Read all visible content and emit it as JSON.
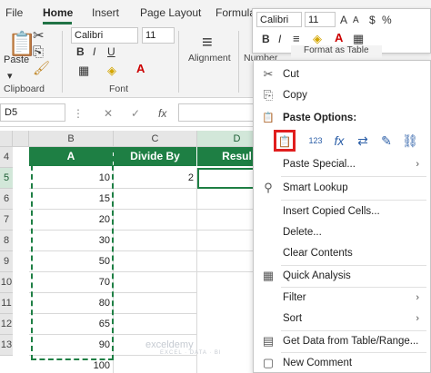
{
  "ribbon": {
    "tabs": [
      "File",
      "Home",
      "Insert",
      "Page Layout",
      "Formula"
    ],
    "active_tab": "Home",
    "paste_label": "Paste",
    "clipboard_label": "Clipboard",
    "font_name": "Calibri",
    "font_size": "11",
    "font_label": "Font",
    "alignment_label": "Alignment",
    "number_label": "Number",
    "format_as_table": "Format as Table"
  },
  "formula_bar": {
    "name_box": "D5",
    "fx": "fx"
  },
  "columns": [
    "B",
    "C",
    "D"
  ],
  "row_numbers": [
    "4",
    "5",
    "6",
    "7",
    "8",
    "9",
    "10",
    "11",
    "12",
    "13"
  ],
  "table": {
    "headers": [
      "A",
      "Divide By",
      "Resul"
    ],
    "col_a": [
      "10",
      "15",
      "20",
      "30",
      "50",
      "70",
      "80",
      "65",
      "90",
      "100"
    ],
    "col_b": [
      "2",
      "",
      "",
      "",
      "",
      "",
      "",
      "",
      "",
      ""
    ]
  },
  "watermark": {
    "name": "exceldemy",
    "sub": "EXCEL · DATA · BI"
  },
  "mini_toolbar": {
    "font_name": "Calibri",
    "font_size": "11",
    "bold": "B",
    "italic": "I"
  },
  "context_menu": {
    "items": [
      {
        "label": "Cut",
        "icon": "scissors-icon",
        "glyph": "✂"
      },
      {
        "label": "Copy",
        "icon": "copy-icon",
        "glyph": "⎘"
      },
      {
        "label": "Paste Options:",
        "icon": "clipboard-icon",
        "glyph": "📋"
      },
      {
        "label": "Paste Special...",
        "icon": "",
        "glyph": ""
      },
      {
        "label": "Smart Lookup",
        "icon": "search-icon",
        "glyph": "⚲"
      },
      {
        "label": "Insert Copied Cells...",
        "icon": "",
        "glyph": ""
      },
      {
        "label": "Delete...",
        "icon": "",
        "glyph": ""
      },
      {
        "label": "Clear Contents",
        "icon": "",
        "glyph": ""
      },
      {
        "label": "Quick Analysis",
        "icon": "quick-analysis-icon",
        "glyph": "▦"
      },
      {
        "label": "Filter",
        "icon": "",
        "glyph": ""
      },
      {
        "label": "Sort",
        "icon": "",
        "glyph": ""
      },
      {
        "label": "Get Data from Table/Range...",
        "icon": "table-icon",
        "glyph": "▤"
      },
      {
        "label": "New Comment",
        "icon": "comment-icon",
        "glyph": "▢"
      }
    ],
    "paste_buttons": [
      "paste",
      "values",
      "formulas",
      "transpose",
      "formatting",
      "paste-link"
    ],
    "paste_glyphs": [
      "📋",
      "123",
      "fx",
      "⇄",
      "✎",
      "⛓"
    ],
    "submenu_arrow": "›",
    "highlight_color": "#e01e1e"
  }
}
